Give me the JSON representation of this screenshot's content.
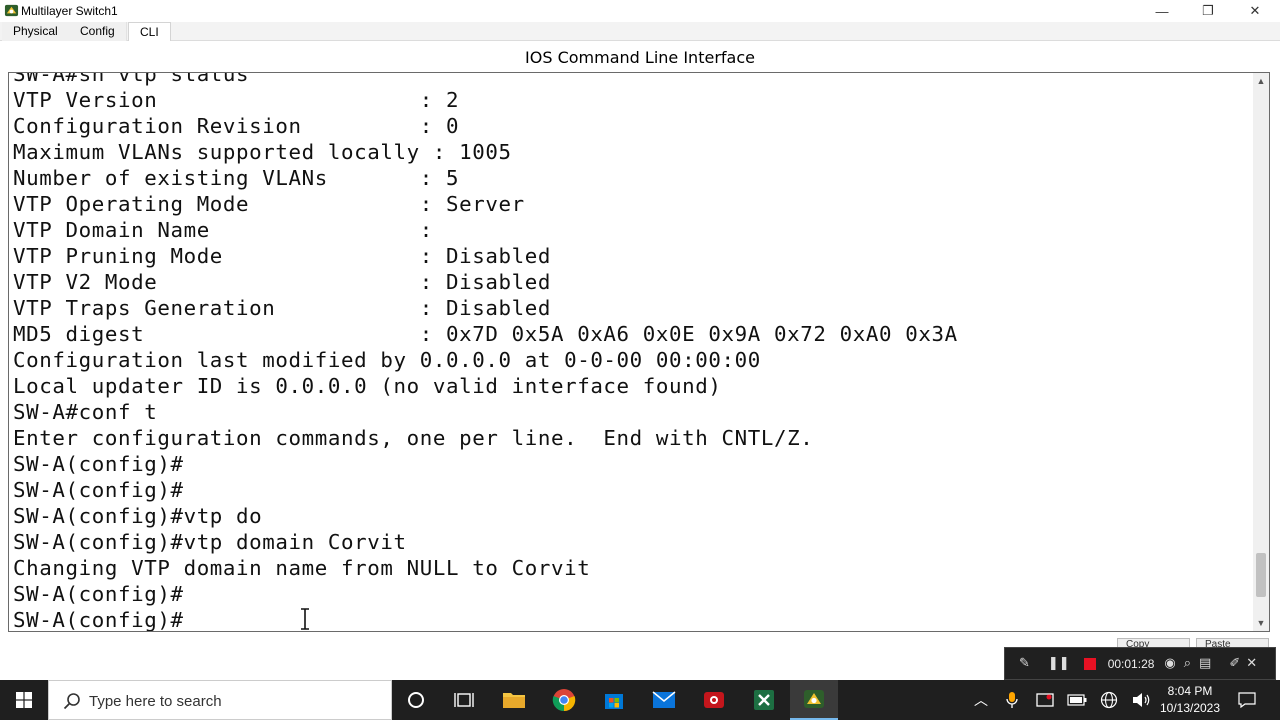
{
  "window": {
    "title": "Multilayer Switch1",
    "minimize_glyph": "—",
    "maximize_glyph": "❐",
    "close_glyph": "✕"
  },
  "tabs": [
    {
      "label": "Physical"
    },
    {
      "label": "Config"
    },
    {
      "label": "CLI",
      "active": true
    }
  ],
  "cli": {
    "heading": "IOS Command Line Interface",
    "lines": [
      "SW-A#sh vtp status",
      "VTP Version                    : 2",
      "Configuration Revision         : 0",
      "Maximum VLANs supported locally : 1005",
      "Number of existing VLANs       : 5",
      "VTP Operating Mode             : Server",
      "VTP Domain Name                :",
      "VTP Pruning Mode               : Disabled",
      "VTP V2 Mode                    : Disabled",
      "VTP Traps Generation           : Disabled",
      "MD5 digest                     : 0x7D 0x5A 0xA6 0x0E 0x9A 0x72 0xA0 0x3A",
      "Configuration last modified by 0.0.0.0 at 0-0-00 00:00:00",
      "Local updater ID is 0.0.0.0 (no valid interface found)",
      "SW-A#conf t",
      "Enter configuration commands, one per line.  End with CNTL/Z.",
      "SW-A(config)#",
      "SW-A(config)#",
      "SW-A(config)#vtp do",
      "SW-A(config)#vtp domain Corvit",
      "Changing VTP domain name from NULL to Corvit",
      "SW-A(config)#",
      "SW-A(config)#"
    ],
    "scroll_position": 0.92
  },
  "buttons": {
    "copy": "Copy",
    "paste": "Paste"
  },
  "recorder": {
    "elapsed": "00:01:28"
  },
  "taskbar": {
    "search_placeholder": "Type here to search",
    "time": "8:04 PM",
    "date": "10/13/2023"
  },
  "colors": {
    "taskbar_bg": "#1f1f1f",
    "terminal_border": "#6a6a6a",
    "recorder_stop": "#e81123",
    "chrome_accent": "#76b9ed"
  }
}
